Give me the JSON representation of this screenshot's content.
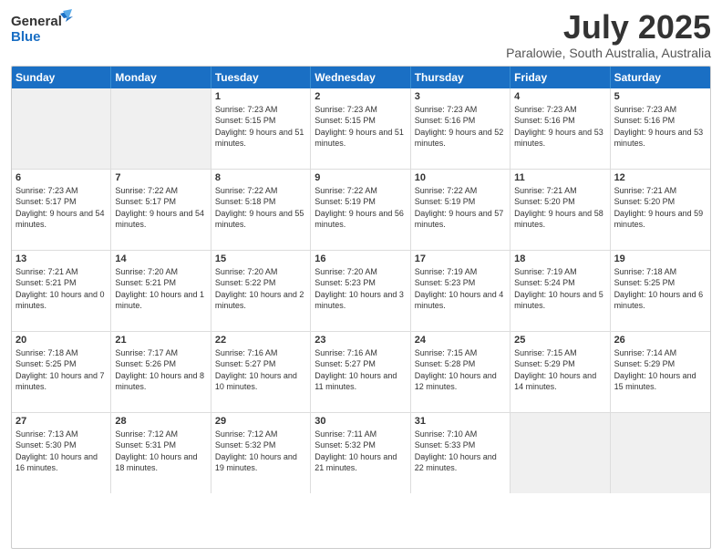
{
  "header": {
    "logo_general": "General",
    "logo_blue": "Blue",
    "month_title": "July 2025",
    "subtitle": "Paralowie, South Australia, Australia"
  },
  "calendar": {
    "days_of_week": [
      "Sunday",
      "Monday",
      "Tuesday",
      "Wednesday",
      "Thursday",
      "Friday",
      "Saturday"
    ],
    "rows": [
      [
        {
          "day": "",
          "sunrise": "",
          "sunset": "",
          "daylight": "",
          "empty": true
        },
        {
          "day": "",
          "sunrise": "",
          "sunset": "",
          "daylight": "",
          "empty": true
        },
        {
          "day": "1",
          "sunrise": "Sunrise: 7:23 AM",
          "sunset": "Sunset: 5:15 PM",
          "daylight": "Daylight: 9 hours and 51 minutes."
        },
        {
          "day": "2",
          "sunrise": "Sunrise: 7:23 AM",
          "sunset": "Sunset: 5:15 PM",
          "daylight": "Daylight: 9 hours and 51 minutes."
        },
        {
          "day": "3",
          "sunrise": "Sunrise: 7:23 AM",
          "sunset": "Sunset: 5:16 PM",
          "daylight": "Daylight: 9 hours and 52 minutes."
        },
        {
          "day": "4",
          "sunrise": "Sunrise: 7:23 AM",
          "sunset": "Sunset: 5:16 PM",
          "daylight": "Daylight: 9 hours and 53 minutes."
        },
        {
          "day": "5",
          "sunrise": "Sunrise: 7:23 AM",
          "sunset": "Sunset: 5:16 PM",
          "daylight": "Daylight: 9 hours and 53 minutes."
        }
      ],
      [
        {
          "day": "6",
          "sunrise": "Sunrise: 7:23 AM",
          "sunset": "Sunset: 5:17 PM",
          "daylight": "Daylight: 9 hours and 54 minutes."
        },
        {
          "day": "7",
          "sunrise": "Sunrise: 7:22 AM",
          "sunset": "Sunset: 5:17 PM",
          "daylight": "Daylight: 9 hours and 54 minutes."
        },
        {
          "day": "8",
          "sunrise": "Sunrise: 7:22 AM",
          "sunset": "Sunset: 5:18 PM",
          "daylight": "Daylight: 9 hours and 55 minutes."
        },
        {
          "day": "9",
          "sunrise": "Sunrise: 7:22 AM",
          "sunset": "Sunset: 5:19 PM",
          "daylight": "Daylight: 9 hours and 56 minutes."
        },
        {
          "day": "10",
          "sunrise": "Sunrise: 7:22 AM",
          "sunset": "Sunset: 5:19 PM",
          "daylight": "Daylight: 9 hours and 57 minutes."
        },
        {
          "day": "11",
          "sunrise": "Sunrise: 7:21 AM",
          "sunset": "Sunset: 5:20 PM",
          "daylight": "Daylight: 9 hours and 58 minutes."
        },
        {
          "day": "12",
          "sunrise": "Sunrise: 7:21 AM",
          "sunset": "Sunset: 5:20 PM",
          "daylight": "Daylight: 9 hours and 59 minutes."
        }
      ],
      [
        {
          "day": "13",
          "sunrise": "Sunrise: 7:21 AM",
          "sunset": "Sunset: 5:21 PM",
          "daylight": "Daylight: 10 hours and 0 minutes."
        },
        {
          "day": "14",
          "sunrise": "Sunrise: 7:20 AM",
          "sunset": "Sunset: 5:21 PM",
          "daylight": "Daylight: 10 hours and 1 minute."
        },
        {
          "day": "15",
          "sunrise": "Sunrise: 7:20 AM",
          "sunset": "Sunset: 5:22 PM",
          "daylight": "Daylight: 10 hours and 2 minutes."
        },
        {
          "day": "16",
          "sunrise": "Sunrise: 7:20 AM",
          "sunset": "Sunset: 5:23 PM",
          "daylight": "Daylight: 10 hours and 3 minutes."
        },
        {
          "day": "17",
          "sunrise": "Sunrise: 7:19 AM",
          "sunset": "Sunset: 5:23 PM",
          "daylight": "Daylight: 10 hours and 4 minutes."
        },
        {
          "day": "18",
          "sunrise": "Sunrise: 7:19 AM",
          "sunset": "Sunset: 5:24 PM",
          "daylight": "Daylight: 10 hours and 5 minutes."
        },
        {
          "day": "19",
          "sunrise": "Sunrise: 7:18 AM",
          "sunset": "Sunset: 5:25 PM",
          "daylight": "Daylight: 10 hours and 6 minutes."
        }
      ],
      [
        {
          "day": "20",
          "sunrise": "Sunrise: 7:18 AM",
          "sunset": "Sunset: 5:25 PM",
          "daylight": "Daylight: 10 hours and 7 minutes."
        },
        {
          "day": "21",
          "sunrise": "Sunrise: 7:17 AM",
          "sunset": "Sunset: 5:26 PM",
          "daylight": "Daylight: 10 hours and 8 minutes."
        },
        {
          "day": "22",
          "sunrise": "Sunrise: 7:16 AM",
          "sunset": "Sunset: 5:27 PM",
          "daylight": "Daylight: 10 hours and 10 minutes."
        },
        {
          "day": "23",
          "sunrise": "Sunrise: 7:16 AM",
          "sunset": "Sunset: 5:27 PM",
          "daylight": "Daylight: 10 hours and 11 minutes."
        },
        {
          "day": "24",
          "sunrise": "Sunrise: 7:15 AM",
          "sunset": "Sunset: 5:28 PM",
          "daylight": "Daylight: 10 hours and 12 minutes."
        },
        {
          "day": "25",
          "sunrise": "Sunrise: 7:15 AM",
          "sunset": "Sunset: 5:29 PM",
          "daylight": "Daylight: 10 hours and 14 minutes."
        },
        {
          "day": "26",
          "sunrise": "Sunrise: 7:14 AM",
          "sunset": "Sunset: 5:29 PM",
          "daylight": "Daylight: 10 hours and 15 minutes."
        }
      ],
      [
        {
          "day": "27",
          "sunrise": "Sunrise: 7:13 AM",
          "sunset": "Sunset: 5:30 PM",
          "daylight": "Daylight: 10 hours and 16 minutes."
        },
        {
          "day": "28",
          "sunrise": "Sunrise: 7:12 AM",
          "sunset": "Sunset: 5:31 PM",
          "daylight": "Daylight: 10 hours and 18 minutes."
        },
        {
          "day": "29",
          "sunrise": "Sunrise: 7:12 AM",
          "sunset": "Sunset: 5:32 PM",
          "daylight": "Daylight: 10 hours and 19 minutes."
        },
        {
          "day": "30",
          "sunrise": "Sunrise: 7:11 AM",
          "sunset": "Sunset: 5:32 PM",
          "daylight": "Daylight: 10 hours and 21 minutes."
        },
        {
          "day": "31",
          "sunrise": "Sunrise: 7:10 AM",
          "sunset": "Sunset: 5:33 PM",
          "daylight": "Daylight: 10 hours and 22 minutes."
        },
        {
          "day": "",
          "sunrise": "",
          "sunset": "",
          "daylight": "",
          "empty": true
        },
        {
          "day": "",
          "sunrise": "",
          "sunset": "",
          "daylight": "",
          "empty": true
        }
      ]
    ]
  }
}
